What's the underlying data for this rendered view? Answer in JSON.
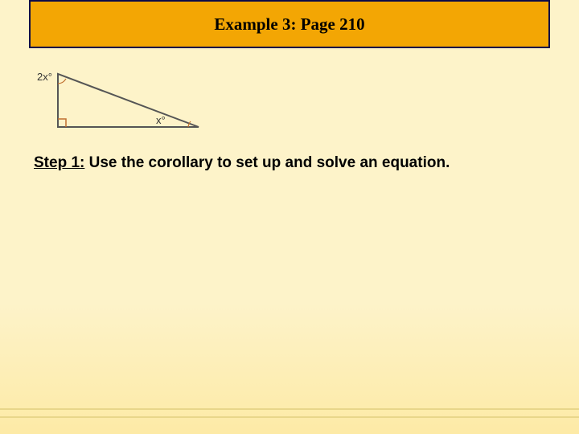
{
  "header": {
    "title": "Example 3: Page 210"
  },
  "figure": {
    "angle_top": "2x°",
    "angle_bottom_right": "x°"
  },
  "step": {
    "heading": "Step 1:",
    "body": " Use the corollary to set up and solve an equation."
  }
}
